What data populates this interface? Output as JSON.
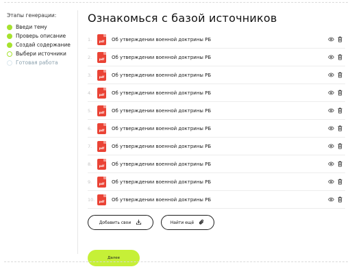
{
  "sidebar": {
    "title": "Этапы генерации:",
    "steps": [
      {
        "label": "Введи тему",
        "state": "done"
      },
      {
        "label": "Проверь описание",
        "state": "done"
      },
      {
        "label": "Создай содержание",
        "state": "done"
      },
      {
        "label": "Выбери источники",
        "state": "current"
      },
      {
        "label": "Готовая работа",
        "state": "pending"
      }
    ]
  },
  "main": {
    "title": "Ознакомься с базой источников",
    "items": [
      {
        "num": "1.",
        "icon": "pdf",
        "title": "Об утверждении военной доктрины РБ"
      },
      {
        "num": "2.",
        "icon": "pdf",
        "title": "Об утверждении военной доктрины РБ"
      },
      {
        "num": "3.",
        "icon": "pdf",
        "title": "Об утверждении военной доктрины РБ"
      },
      {
        "num": "4.",
        "icon": "pdf",
        "title": "Об утверждении военной доктрины РБ"
      },
      {
        "num": "5.",
        "icon": "pdf",
        "title": "Об утверждении военной доктрины РБ"
      },
      {
        "num": "6.",
        "icon": "pdf",
        "title": "Об утверждении военной доктрины РБ"
      },
      {
        "num": "7.",
        "icon": "pdf",
        "title": "Об утверждении военной доктрины РБ"
      },
      {
        "num": "8.",
        "icon": "pdf",
        "title": "Об утверждении военной доктрины РБ"
      },
      {
        "num": "9.",
        "icon": "pdf",
        "title": "Об утверждении военной доктрины РБ"
      },
      {
        "num": "10.",
        "icon": "pdf",
        "title": "Об утверждении военной доктрины РБ"
      }
    ],
    "add_button": "Добавить свои",
    "find_button": "Найти ещё",
    "next_button": "Далее"
  },
  "colors": {
    "accent": "#a6e22e",
    "next_button": "#c6f037",
    "pdf_red": "#ea4335"
  }
}
